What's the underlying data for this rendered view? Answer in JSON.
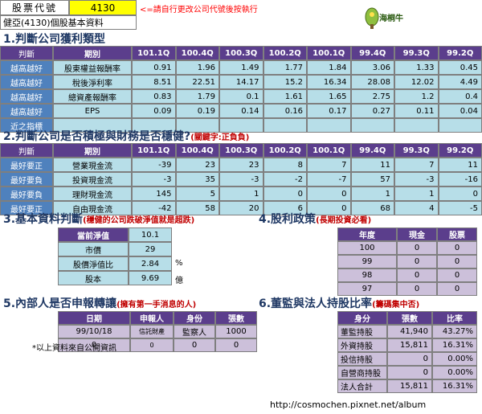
{
  "header": {
    "code_label": "股票代號",
    "code_value": "4130",
    "hint": "<=請自行更改公司代號後按執行",
    "company": "健亞(4130)個股基本資料",
    "logo_text": "海桐牛"
  },
  "section1": {
    "title": "1.判斷公司獲利類型",
    "judge_label": "判斷",
    "period_label": "期別",
    "periods": [
      "101.1Q",
      "100.4Q",
      "100.3Q",
      "100.2Q",
      "100.1Q",
      "99.4Q",
      "99.3Q",
      "99.2Q"
    ],
    "rows": [
      {
        "judge": "越高越好",
        "name": "股東權益報酬率",
        "values": [
          "0.91",
          "1.96",
          "1.49",
          "1.77",
          "1.84",
          "3.06",
          "1.33",
          "0.45"
        ]
      },
      {
        "judge": "越高越好",
        "name": "稅後淨利率",
        "values": [
          "8.51",
          "22.51",
          "14.17",
          "15.2",
          "16.34",
          "28.08",
          "12.02",
          "4.49"
        ]
      },
      {
        "judge": "越高越好",
        "name": "總資產報酬率",
        "values": [
          "0.83",
          "1.79",
          "0.1",
          "1.61",
          "1.65",
          "2.75",
          "1.2",
          "0.4"
        ]
      },
      {
        "judge": "越高越好",
        "name": "EPS",
        "values": [
          "0.09",
          "0.19",
          "0.14",
          "0.16",
          "0.17",
          "0.27",
          "0.11",
          "0.04"
        ]
      },
      {
        "judge": "近之指標",
        "name": "",
        "values": [
          "",
          "",
          "",
          "",
          "",
          "",
          "",
          ""
        ]
      }
    ]
  },
  "section2": {
    "title": "2.判斷公司是否積極與財務是否穩健?",
    "note": "(關鍵字:正負負)",
    "judge_label": "判斷",
    "period_label": "期別",
    "periods": [
      "101.1Q",
      "100.4Q",
      "100.3Q",
      "100.2Q",
      "100.1Q",
      "99.4Q",
      "99.3Q",
      "99.2Q"
    ],
    "rows": [
      {
        "judge": "最好要正",
        "name": "營業現金流",
        "values": [
          "-39",
          "23",
          "23",
          "8",
          "7",
          "11",
          "7",
          "11"
        ]
      },
      {
        "judge": "最好要負",
        "name": "投資現金流",
        "values": [
          "-3",
          "35",
          "-3",
          "-2",
          "-7",
          "57",
          "-3",
          "-16"
        ]
      },
      {
        "judge": "最好要負",
        "name": "理財現金流",
        "values": [
          "145",
          "5",
          "1",
          "0",
          "0",
          "1",
          "1",
          "0"
        ]
      },
      {
        "judge": "最好要正",
        "name": "自由現金流",
        "values": [
          "-42",
          "58",
          "20",
          "6",
          "0",
          "68",
          "4",
          "-5"
        ]
      }
    ]
  },
  "section3": {
    "title": "3.基本資料判斷",
    "note": "(穩健的公司跌破淨值就是超跌)",
    "rows": [
      {
        "label": "當前淨值",
        "value": "10.1",
        "unit": ""
      },
      {
        "label": "市價",
        "value": "29",
        "unit": ""
      },
      {
        "label": "股價淨值比",
        "value": "2.84",
        "unit": "%"
      },
      {
        "label": "股本",
        "value": "9.69",
        "unit": "億"
      }
    ]
  },
  "section4": {
    "title": "4.股利政策",
    "note": "(長期投資必看)",
    "headers": [
      "年度",
      "現金",
      "股票"
    ],
    "rows": [
      [
        "100",
        "0",
        "0"
      ],
      [
        "99",
        "0",
        "0"
      ],
      [
        "98",
        "0",
        "0"
      ],
      [
        "97",
        "0",
        "0"
      ]
    ]
  },
  "section5": {
    "title": "5.內部人是否申報轉讓",
    "note": "(擁有第一手消息的人)",
    "headers": [
      "日期",
      "申報人",
      "身份",
      "張數"
    ],
    "rows": [
      [
        "99/10/18",
        "信託財產",
        "監察人",
        "1000"
      ],
      [
        "0",
        "0",
        "0",
        "0"
      ]
    ],
    "footnote": "*以上資料來自公開資訊"
  },
  "section6": {
    "title": "6.董監與法人持股比率",
    "note": "(籌碼集中否)",
    "headers": [
      "身分",
      "張數",
      "比率"
    ],
    "rows": [
      [
        "董監持股",
        "41,940",
        "43.27%"
      ],
      [
        "外資持股",
        "15,811",
        "16.31%"
      ],
      [
        "投信持股",
        "0",
        "0.00%"
      ],
      [
        "自營商持股",
        "0",
        "0.00%"
      ],
      [
        "法人合計",
        "15,811",
        "16.31%"
      ]
    ]
  },
  "footer": {
    "url": "http://cosmochen.pixnet.net/album"
  }
}
